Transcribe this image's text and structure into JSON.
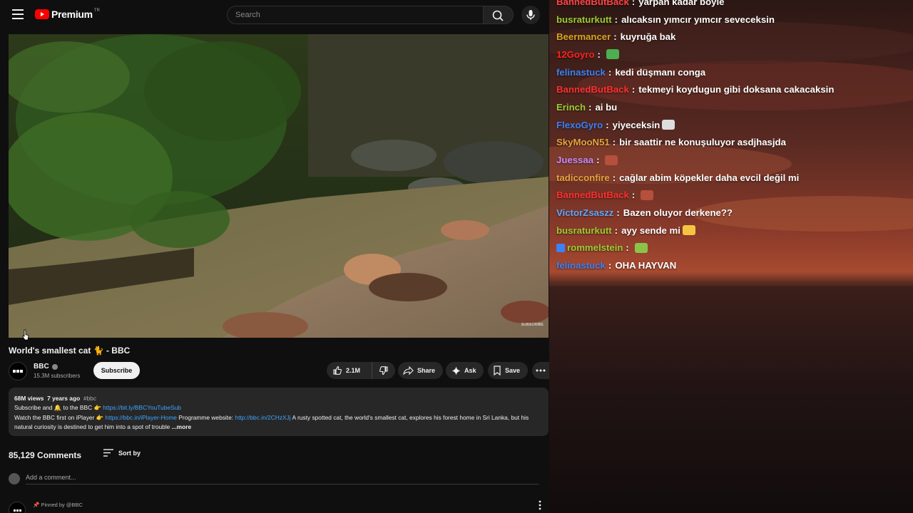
{
  "topbar": {
    "brand": "Premium",
    "region": "TR",
    "search_placeholder": "Search"
  },
  "player": {
    "watermark": "SUBSCRIBE"
  },
  "video": {
    "title": "World's smallest cat 🐈 - BBC",
    "channel": "BBC",
    "subscribers": "15.3M subscribers",
    "subscribe_label": "Subscribe",
    "likes": "2.1M",
    "share_label": "Share",
    "ask_label": "Ask",
    "save_label": "Save"
  },
  "description": {
    "views": "68M views",
    "age": "7 years ago",
    "hashtag": "#bbc",
    "line1_prefix": "Subscribe and 🔔 to the BBC 👉",
    "link1": "https://bit.ly/BBCYouTubeSub",
    "line2_prefix": "Watch the BBC first on iPlayer 👉",
    "link2": "https://bbc.in/iPlayer-Home",
    "programme_label": "Programme website:",
    "link3": "http://bbc.in/2CHzXJj",
    "line2_suffix": "A rusty spotted cat, the world's smallest cat, explores his forest home in",
    "line3": "Sri Lanka, but his natural curiosity is destined to get him into a spot of trouble",
    "more_label": "...more"
  },
  "comments": {
    "count": "85,129 Comments",
    "sort_label": "Sort by",
    "placeholder": "Add a comment...",
    "pinned_label": "Pinned by @BBC"
  },
  "chat": {
    "messages": [
      {
        "user": "BannedButBack",
        "color": "#ff4444",
        "text": "yarpan kadar böyle"
      },
      {
        "user": "busraturkutt",
        "color": "#9acd32",
        "text": "alıcaksın yımcır yımcır seveceksin"
      },
      {
        "user": "Beermancer",
        "color": "#daa520",
        "text": "kuyruğa bak"
      },
      {
        "user": "12Goyro",
        "color": "#ff2222",
        "text": "",
        "emote": "#4caf50"
      },
      {
        "user": "felinastuck",
        "color": "#3b82f6",
        "text": "kedi düşmanı conga"
      },
      {
        "user": "BannedButBack",
        "color": "#ff3030",
        "text": "tekmeyi koydugun gibi doksana cakacaksin"
      },
      {
        "user": "Erinch",
        "color": "#9acd32",
        "text": "ai bu"
      },
      {
        "user": "FlexoGyro",
        "color": "#3b82f6",
        "text": "yiyeceksin",
        "emote": "#dddddd"
      },
      {
        "user": "SkyMooN51",
        "color": "#e8a33d",
        "text": "bir saattir ne konuşuluyor asdjhasjda"
      },
      {
        "user": "Juessaa",
        "color": "#c58af9",
        "text": "",
        "emote": "#b5503c"
      },
      {
        "user": "tadicconfire",
        "color": "#e8a33d",
        "text": "cağlar abim köpekler daha evcil değil mi"
      },
      {
        "user": "BannedButBack",
        "color": "#ff3030",
        "text": "",
        "emote": "#b5503c"
      },
      {
        "user": "VictorZsaszz",
        "color": "#5fa8ff",
        "text": "Bazen oluyor derkene??"
      },
      {
        "user": "busraturkutt",
        "color": "#9acd32",
        "text": "ayy sende mi",
        "emote": "#f5c542"
      },
      {
        "user": "rommelstein",
        "color": "#9acd32",
        "text": "",
        "emote": "#8bc34a",
        "badge": true
      },
      {
        "user": "felinastuck",
        "color": "#3b82f6",
        "text": "OHA HAYVAN"
      }
    ]
  }
}
